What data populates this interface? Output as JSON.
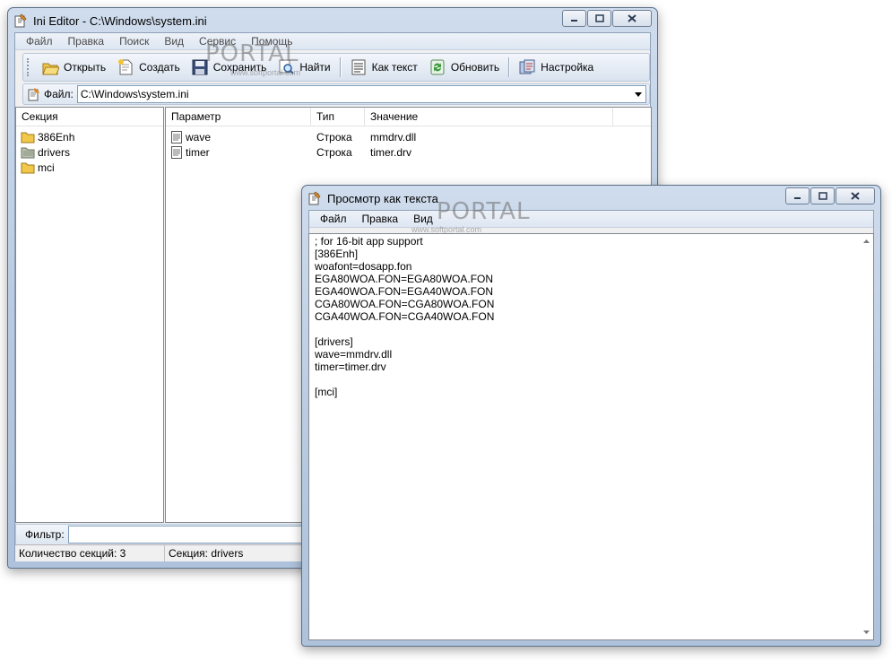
{
  "main_window": {
    "title": "Ini Editor - C:\\Windows\\system.ini",
    "menu": [
      "Файл",
      "Правка",
      "Поиск",
      "Вид",
      "Сервис",
      "Помощь"
    ],
    "toolbar": {
      "open": "Открыть",
      "create": "Создать",
      "save": "Сохранить",
      "find": "Найти",
      "as_text": "Как текст",
      "refresh": "Обновить",
      "settings": "Настройка"
    },
    "file_label": "Файл:",
    "file_path": "C:\\Windows\\system.ini",
    "sections_header": "Секция",
    "sections": [
      {
        "name": "386Enh",
        "icon": "folder-icon"
      },
      {
        "name": "drivers",
        "icon": "folder-open-icon"
      },
      {
        "name": "mci",
        "icon": "folder-icon"
      }
    ],
    "params_columns": [
      "Параметр",
      "Тип",
      "Значение"
    ],
    "params": [
      {
        "name": "wave",
        "type": "Строка",
        "value": "mmdrv.dll"
      },
      {
        "name": "timer",
        "type": "Строка",
        "value": "timer.drv"
      }
    ],
    "filter_label": "Фильтр:",
    "filter_value": "",
    "status": {
      "sections_count": "Количество секций: 3",
      "current_section": "Секция: drivers"
    }
  },
  "text_window": {
    "title": "Просмотр как текста",
    "menu": [
      "Файл",
      "Правка",
      "Вид"
    ],
    "lines": [
      "; for 16-bit app support",
      "[386Enh]",
      "woafont=dosapp.fon",
      "EGA80WOA.FON=EGA80WOA.FON",
      "EGA40WOA.FON=EGA40WOA.FON",
      "CGA80WOA.FON=CGA80WOA.FON",
      "CGA40WOA.FON=CGA40WOA.FON",
      "",
      "[drivers]",
      "wave=mmdrv.dll",
      "timer=timer.drv",
      "",
      "[mci]"
    ]
  },
  "watermark": {
    "logo": "PORTAL",
    "url": "www.softportal.com"
  },
  "colors": {
    "frame": "#b7c9e0",
    "folder": "#f2c84b",
    "accent_green": "#3b9a3b"
  }
}
